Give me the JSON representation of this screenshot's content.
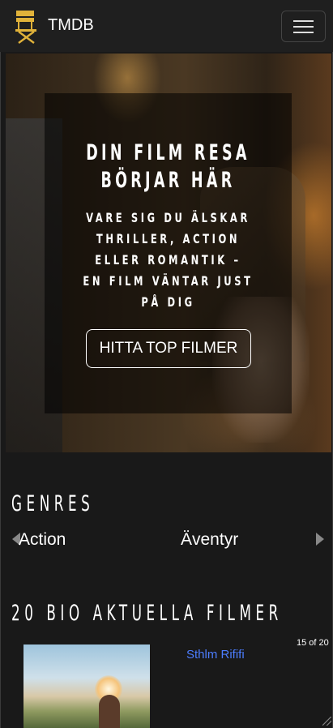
{
  "navbar": {
    "brand": "TMDB",
    "logo_icon": "director-chair-icon",
    "menu_icon": "hamburger-icon",
    "accent": "#e0b23a"
  },
  "hero": {
    "title": "DIN FILM RESA BÖRJAR HÄR",
    "subtitle": "VARE SIG DU ÄLSKAR THRILLER, ACTION ELLER ROMANTIK – EN FILM VÄNTAR JUST PÅ DIG",
    "button_label": "HITTA TOP FILMER"
  },
  "genres": {
    "heading": "GENRES",
    "items": [
      "Action",
      "Äventyr"
    ],
    "prev_icon": "chevron-left-icon",
    "next_icon": "chevron-right-icon"
  },
  "movies": {
    "heading": "20 BIO AKTUELLA FILMER",
    "counter": "15 of 20",
    "current_title": "Sthlm Rififi",
    "title_color": "#4c7dff"
  }
}
